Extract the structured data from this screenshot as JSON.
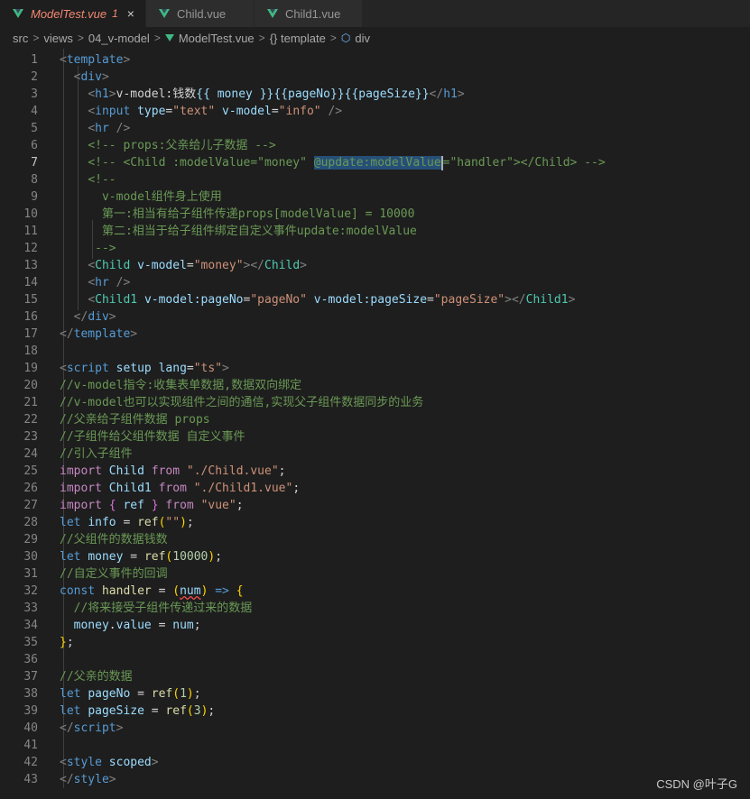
{
  "tabs": [
    {
      "label": "ModelTest.vue",
      "badge": "1",
      "close": "×"
    },
    {
      "label": "Child.vue"
    },
    {
      "label": "Child1.vue"
    }
  ],
  "breadcrumb": {
    "items": [
      "src",
      "views",
      "04_v-model",
      "ModelTest.vue",
      "{} template",
      "div"
    ],
    "separator": ">"
  },
  "editor": {
    "line_numbers": [
      "1",
      "2",
      "3",
      "4",
      "5",
      "6",
      "7",
      "8",
      "9",
      "10",
      "11",
      "12",
      "13",
      "14",
      "15",
      "16",
      "17",
      "18",
      "19",
      "20",
      "21",
      "22",
      "23",
      "24",
      "25",
      "26",
      "27",
      "28",
      "29",
      "30",
      "31",
      "32",
      "33",
      "34",
      "35",
      "36",
      "37",
      "38",
      "39",
      "40",
      "41",
      "42",
      "43"
    ],
    "current_line": "7",
    "lines": {
      "l3_text": "v-model:钱数",
      "l3_m1": "{{ money }}",
      "l3_m2": "{{pageNo}}",
      "l3_m3": "{{pageSize}}",
      "l6": "<!-- props:父亲给儿子数据 -->",
      "l7a": "<!-- <Child :modelValue=\"money\" ",
      "l7b": "@update:modelValue",
      "l7c": "=\"handler\"></Child> -->",
      "l8": "<!--",
      "l9": "v-model组件身上使用",
      "l10": "第一:相当有给子组件传递props[modelValue] = 10000",
      "l11": "第二:相当于给子组件绑定自定义事件update:modelValue",
      "l12": "-->",
      "l20": "//v-model指令:收集表单数据,数据双向绑定",
      "l21": "//v-model也可以实现组件之间的通信,实现父子组件数据同步的业务",
      "l22": "//父亲给子组件数据 props",
      "l23": "//子组件给父组件数据 自定义事件",
      "l24": "//引入子组件",
      "l29": "//父组件的数据钱数",
      "l31": "//自定义事件的回调",
      "l33": "//将来接受子组件传递过来的数据",
      "l37": "//父亲的数据"
    }
  },
  "watermark": "CSDN @叶子G"
}
